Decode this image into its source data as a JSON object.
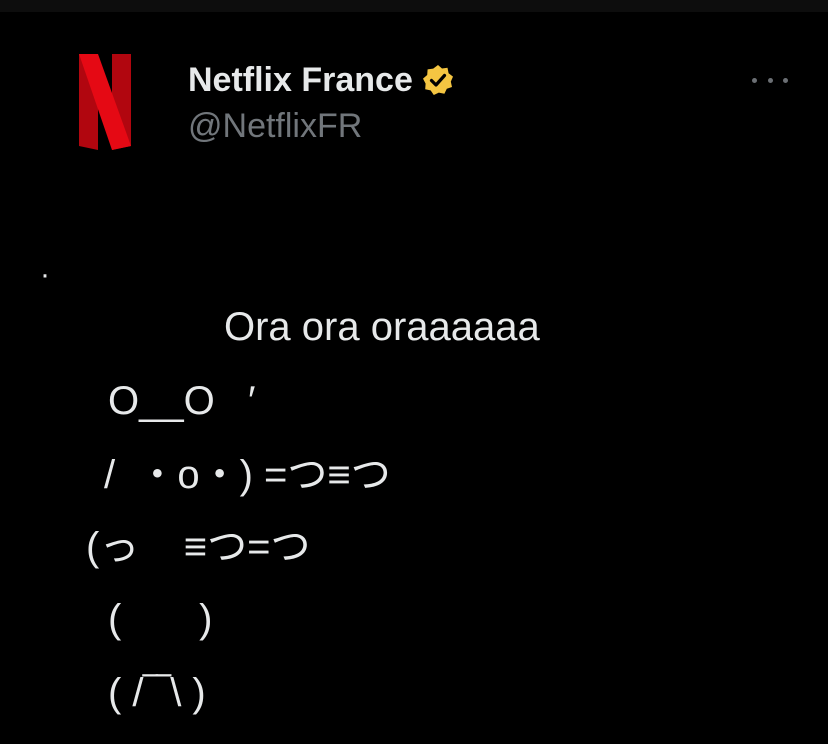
{
  "tweet": {
    "author": {
      "display_name": "Netflix France",
      "handle": "@NetflixFR",
      "avatar_icon": "netflix-logo",
      "verified": true,
      "verified_color": "#f4c542"
    },
    "more_icon": "ellipsis-icon",
    "text_lines": [
      "·",
      "Ora ora oraaaaaa",
      "O__O   ′",
      "/  ・o・) =つ≡つ",
      "(っ    ≡つ=つ",
      "(       )",
      "( /‾‾\\ )"
    ]
  },
  "colors": {
    "background": "#000000",
    "text": "#e7e9ea",
    "secondary_text": "#71767b",
    "brand_red": "#e50914"
  }
}
